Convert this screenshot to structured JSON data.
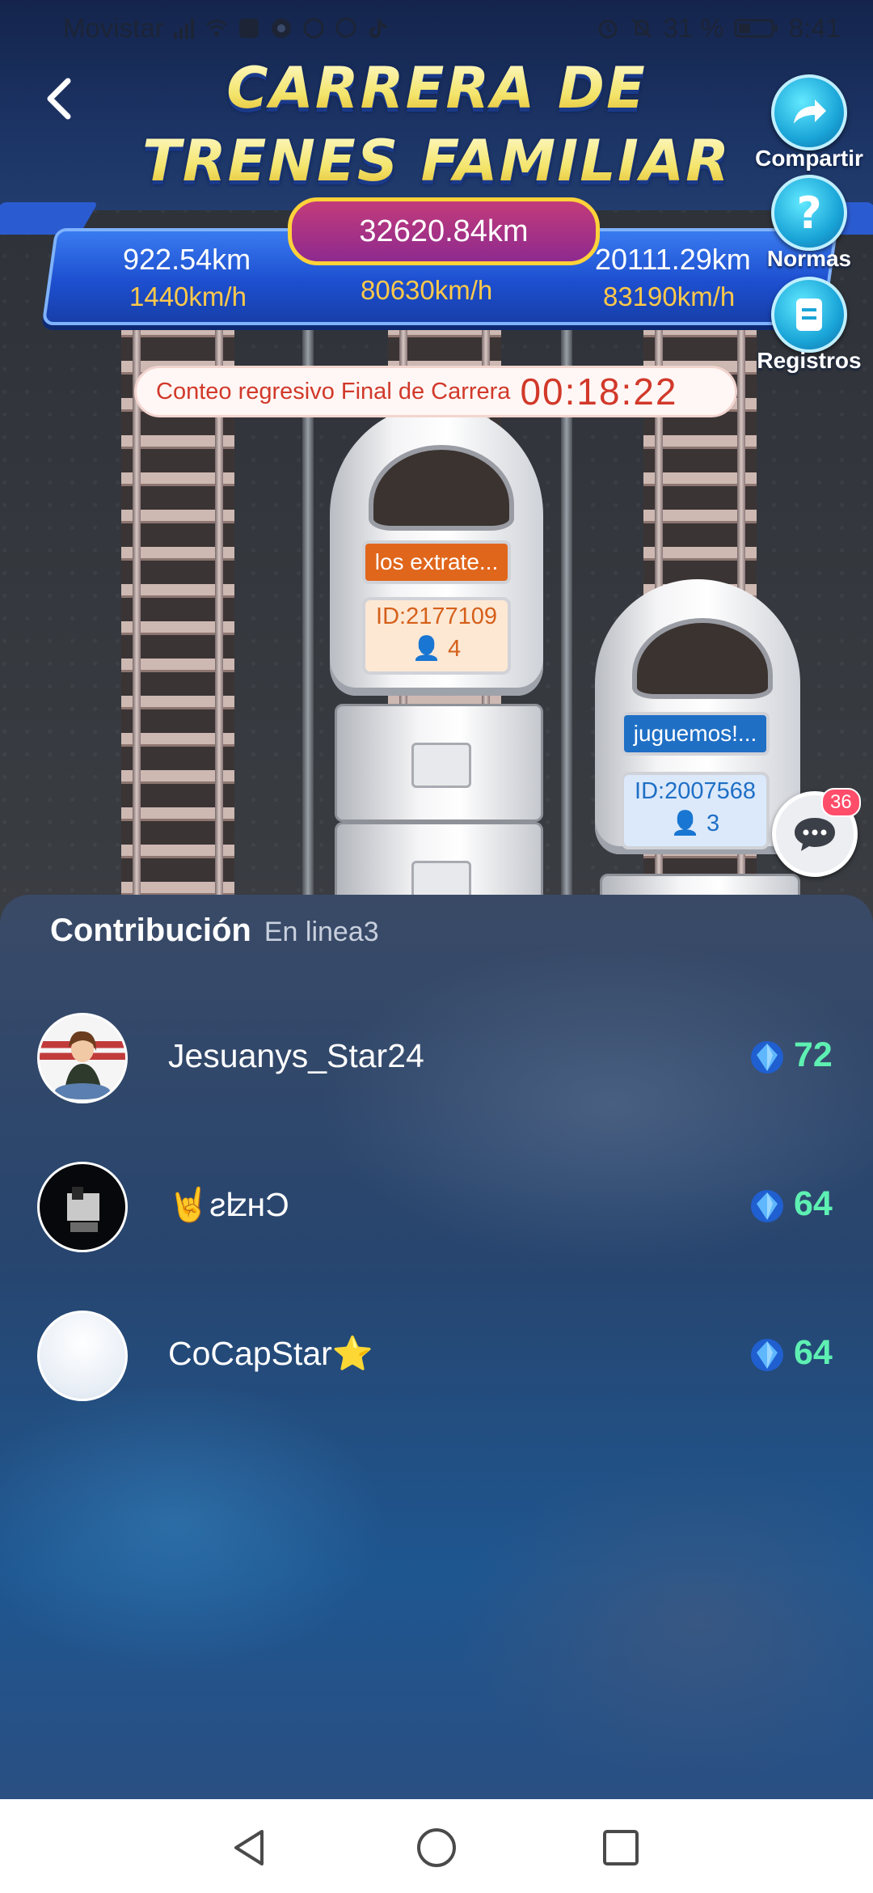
{
  "status_bar": {
    "carrier": "Movistar",
    "battery": "31 %",
    "time": "8:41",
    "icons": [
      "signal-icon",
      "wifi-icon",
      "app-icon",
      "chrome-icon",
      "whatsapp-icon",
      "messenger-icon",
      "tiktok-icon",
      "alarm-icon",
      "mute-icon",
      "battery-icon"
    ]
  },
  "header": {
    "title_line1": "CARRERA DE",
    "title_line2": "TRENES FAMILIAR",
    "back_icon": "chevron-left-icon"
  },
  "side_buttons": [
    {
      "label": "Compartir",
      "icon": "share-icon"
    },
    {
      "label": "Normas",
      "icon": "question-icon"
    },
    {
      "label": "Registros",
      "icon": "records-icon"
    }
  ],
  "race": {
    "total_distance": "32620.84km",
    "left": {
      "distance": "922.54km",
      "speed": "1440km/h"
    },
    "center": {
      "speed": "80630km/h"
    },
    "right": {
      "distance": "20111.29km",
      "speed": "83190km/h"
    },
    "countdown_label": "Conteo regresivo Final de Carrera",
    "countdown_time": "00:18:22"
  },
  "trains": [
    {
      "name": "los extrate...",
      "id": "ID:2177109",
      "members": "4",
      "color": "#e0661c"
    },
    {
      "name": "juguemos!...",
      "id": "ID:2007568",
      "members": "3",
      "color": "#1f6fc5"
    }
  ],
  "chat": {
    "badge": "36",
    "icon": "chat-icon"
  },
  "contribution": {
    "title": "Contribución",
    "subtitle": "En linea3",
    "rows": [
      {
        "name": "Jesuanys_Star24",
        "points": "72"
      },
      {
        "name": "🤘ƨʫнƆ",
        "points": "64"
      },
      {
        "name": "CoCapStar⭐",
        "points": "64"
      }
    ]
  },
  "colors": {
    "accent": "#5ef0b2",
    "countdown": "#d1392a",
    "speed": "#ffc94a"
  },
  "navbar": {
    "icons": [
      "back-triangle-icon",
      "home-circle-icon",
      "recents-square-icon"
    ]
  }
}
